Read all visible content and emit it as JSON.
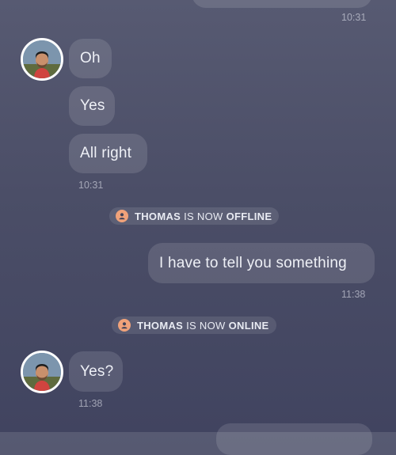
{
  "messages": {
    "top_time": "10:31",
    "incoming_group_1": [
      "Oh",
      "Yes",
      "All right"
    ],
    "incoming_group_1_time": "10:31",
    "outgoing_1": "I have to tell you something",
    "outgoing_1_time": "11:38",
    "incoming_group_2": [
      "Yes?"
    ],
    "incoming_group_2_time": "11:38"
  },
  "status": {
    "offline": {
      "name": "THOMAS",
      "mid": "IS NOW",
      "state": "OFFLINE"
    },
    "online": {
      "name": "THOMAS",
      "mid": "IS NOW",
      "state": "ONLINE"
    }
  },
  "colors": {
    "status_icon": "#f0a27a",
    "background_top": "#575a72",
    "background_bottom": "#414460"
  },
  "icons": {
    "status": "user-icon"
  }
}
